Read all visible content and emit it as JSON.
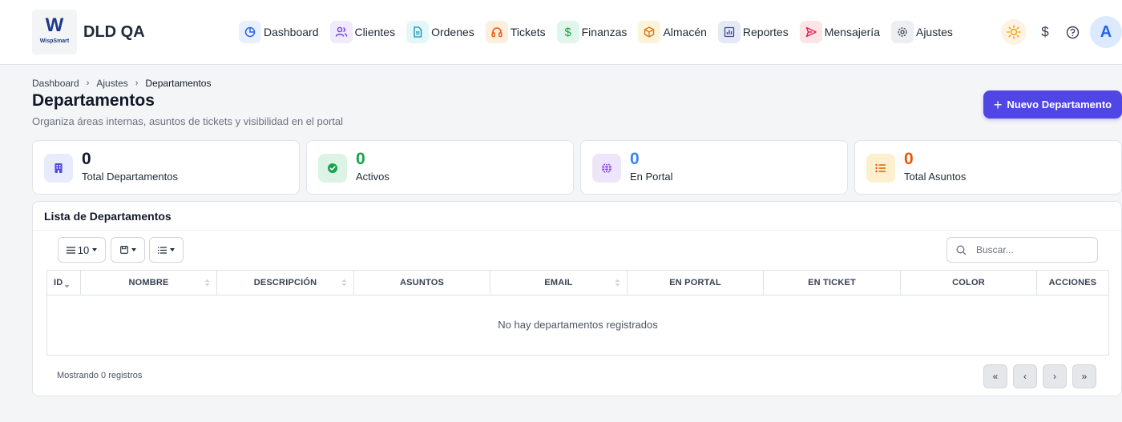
{
  "header": {
    "logo_text": "WispSmart",
    "logo_mark": "W",
    "brand": "DLD QA",
    "nav": [
      {
        "label": "Dashboard",
        "icon": "pie-chart-icon",
        "bg": "#e8effd",
        "color": "#2563eb"
      },
      {
        "label": "Clientes",
        "icon": "users-icon",
        "bg": "#efeafc",
        "color": "#7c3aed"
      },
      {
        "label": "Ordenes",
        "icon": "document-icon",
        "bg": "#e3f6f8",
        "color": "#0891b2"
      },
      {
        "label": "Tickets",
        "icon": "headset-icon",
        "bg": "#feeedd",
        "color": "#ea580c"
      },
      {
        "label": "Finanzas",
        "icon": "dollar-icon",
        "bg": "#e2f5ea",
        "color": "#16a34a"
      },
      {
        "label": "Almacén",
        "icon": "box-icon",
        "bg": "#fdf3d9",
        "color": "#d97706"
      },
      {
        "label": "Reportes",
        "icon": "bar-chart-icon",
        "bg": "#e4e9f5",
        "color": "#3b4a8a"
      },
      {
        "label": "Mensajería",
        "icon": "send-icon",
        "bg": "#fde4e6",
        "color": "#e11d48"
      },
      {
        "label": "Ajustes",
        "icon": "gear-icon",
        "bg": "#eceef1",
        "color": "#374151"
      }
    ],
    "currency_symbol": "$",
    "avatar_initial": "A"
  },
  "breadcrumb": [
    "Dashboard",
    "Ajustes",
    "Departamentos"
  ],
  "page": {
    "title": "Departamentos",
    "subtitle": "Organiza áreas internas, asuntos de tickets y visibilidad en el portal",
    "new_button": "Nuevo Departamento"
  },
  "stats": [
    {
      "value": "0",
      "label": "Total Departamentos",
      "icon": "building-icon",
      "color": "#111827",
      "icon_color": "#4f46e5",
      "icon_bg": "#e8ebfc"
    },
    {
      "value": "0",
      "label": "Activos",
      "icon": "check-circle-icon",
      "color": "#16a34a",
      "icon_color": "#16a34a",
      "icon_bg": "#ddf3e5"
    },
    {
      "value": "0",
      "label": "En Portal",
      "icon": "globe-icon",
      "color": "#3b82f6",
      "icon_color": "#7c3aed",
      "icon_bg": "#ede6fb"
    },
    {
      "value": "0",
      "label": "Total Asuntos",
      "icon": "list-icon",
      "color": "#ea580c",
      "icon_color": "#ea580c",
      "icon_bg": "#fdf0cf"
    }
  ],
  "table": {
    "title": "Lista de Departamentos",
    "page_size": "10",
    "search_placeholder": "Buscar...",
    "columns": [
      "ID",
      "NOMBRE",
      "DESCRIPCIÓN",
      "ASUNTOS",
      "EMAIL",
      "EN PORTAL",
      "EN TICKET",
      "COLOR",
      "ACCIONES"
    ],
    "empty_message": "No hay departamentos registrados",
    "footer_info": "Mostrando 0 registros",
    "pagination": [
      "«",
      "‹",
      "›",
      "»"
    ]
  }
}
